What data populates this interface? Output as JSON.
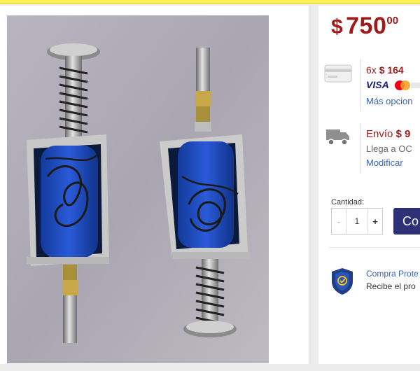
{
  "price": {
    "currency": "$",
    "integer": "750",
    "decimals": "00"
  },
  "installments": {
    "icon": "credit-card-icon",
    "prefix": "6x",
    "amount": "$ 164",
    "brands": [
      "VISA",
      "Mastercard"
    ],
    "more_options_link": "Más opcion"
  },
  "shipping": {
    "icon": "truck-icon",
    "title": "Envío",
    "amount": "$ 9",
    "eta": "Llega a OC",
    "modify_link": "Modificar"
  },
  "quantity": {
    "label": "Cantidad:",
    "value": "1",
    "minus_label": "-",
    "plus_label": "+"
  },
  "buy_button": {
    "label": "Co"
  },
  "protection": {
    "icon": "shield-check-icon",
    "title": "Compra Prote",
    "subtitle": "Recibe el pro"
  },
  "colors": {
    "price": "#a11a1a",
    "link": "#3a63b8",
    "button": "#2d3277",
    "topbar": "#fff159"
  }
}
